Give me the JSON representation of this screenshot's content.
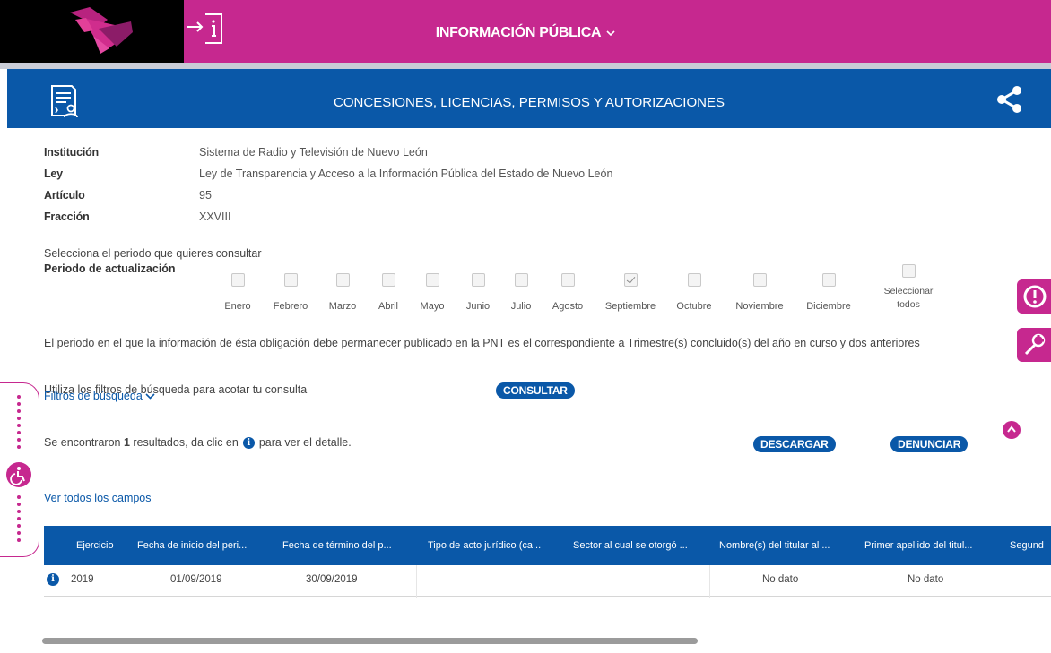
{
  "header": {
    "title": "INFORMACIÓN PÚBLICA",
    "dropdown_icon": "chevron-down-icon",
    "login_icon": "login-info-icon",
    "logo": "Nuevo León logo",
    "colors": {
      "primary": "#c6288f",
      "secondary": "#0a58a8"
    }
  },
  "section": {
    "title": "CONCESIONES, LICENCIAS, PERMISOS Y AUTORIZACIONES",
    "doc_icon": "document-user-icon",
    "share_icon": "share-icon"
  },
  "info": [
    {
      "label": "Institución",
      "value": "Sistema de Radio y Televisión de Nuevo León"
    },
    {
      "label": "Ley",
      "value": "Ley de Transparencia y Acceso a la Información Pública del Estado de Nuevo León"
    },
    {
      "label": "Artículo",
      "value": "95"
    },
    {
      "label": "Fracción",
      "value": "XXVIII"
    }
  ],
  "period": {
    "intro": "Selecciona el periodo que quieres consultar",
    "label": "Periodo de actualización",
    "months": [
      {
        "name": "Enero",
        "checked": false
      },
      {
        "name": "Febrero",
        "checked": false
      },
      {
        "name": "Marzo",
        "checked": false
      },
      {
        "name": "Abril",
        "checked": false
      },
      {
        "name": "Mayo",
        "checked": false
      },
      {
        "name": "Junio",
        "checked": false
      },
      {
        "name": "Julio",
        "checked": false
      },
      {
        "name": "Agosto",
        "checked": false
      },
      {
        "name": "Septiembre",
        "checked": true
      },
      {
        "name": "Octubre",
        "checked": false
      },
      {
        "name": "Noviembre",
        "checked": false
      },
      {
        "name": "Diciembre",
        "checked": false
      }
    ],
    "select_all_line1": "Seleccionar",
    "select_all_line2": "todos"
  },
  "note": "El periodo en el que la información de ésta obligación debe permanecer publicado en la PNT es el correspondiente a Trimestre(s) concluido(s) del año en curso y dos anteriores",
  "filters": {
    "intro": "Utiliza los filtros de búsqueda para acotar tu consulta",
    "consult_button": "CONSULTAR",
    "toggle_label": "Filtros de búsqueda"
  },
  "results": {
    "prefix": "Se encontraron",
    "count": "1",
    "middle": "resultados, da clic en",
    "suffix": "para ver el detalle.",
    "download_button": "DESCARGAR",
    "report_button": "DENUNCIAR",
    "view_all": "Ver todos los campos"
  },
  "table": {
    "columns": [
      "Ejercicio",
      "Fecha de inicio del peri...",
      "Fecha de término del p...",
      "Tipo de acto jurídico (ca...",
      "Sector al cual se otorgó ...",
      "Nombre(s) del titular al ...",
      "Primer apellido del titul...",
      "Segund"
    ],
    "rows": [
      {
        "ejercicio": "2019",
        "inicio": "01/09/2019",
        "termino": "30/09/2019",
        "nombre": "No dato",
        "apellido": "No dato"
      }
    ]
  },
  "side_buttons": [
    "alert-icon",
    "tools-icon",
    "scroll-up-icon"
  ],
  "accessibility_icon": "accessibility-icon"
}
